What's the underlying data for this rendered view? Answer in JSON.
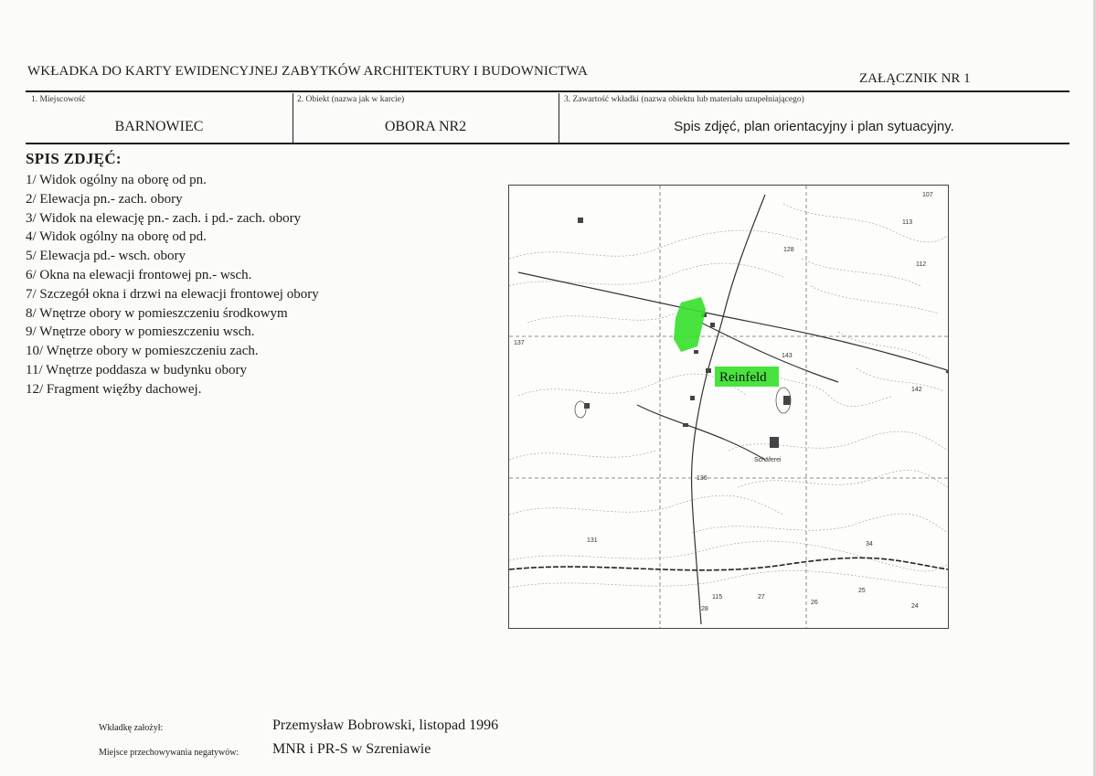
{
  "header": {
    "title": "WKŁADKA DO KARTY EWIDENCYJNEJ ZABYTKÓW ARCHITEKTURY I BUDOWNICTWA",
    "annex": "ZAŁĄCZNIK NR 1"
  },
  "fields": [
    {
      "label": "1. Miejscowość",
      "value": "BARNOWIEC"
    },
    {
      "label": "2. Obiekt (nazwa jak w karcie)",
      "value": "OBORA NR2"
    },
    {
      "label": "3. Zawartość wkładki (nazwa obiektu lub materiału uzupełniającego)",
      "value": "Spis zdjęć, plan orientacyjny i plan sytuacyjny."
    }
  ],
  "photo_list": {
    "title": "SPIS ZDJĘĆ:",
    "items": [
      "1/ Widok ogólny na oborę od pn.",
      "2/ Elewacja pn.- zach. obory",
      "3/ Widok na elewację pn.- zach. i pd.- zach. obory",
      "4/ Widok ogólny na oborę od pd.",
      "5/ Elewacja pd.- wsch. obory",
      "6/ Okna na elewacji frontowej pn.- wsch.",
      "7/ Szczegół okna i drzwi na elewacji frontowej obory",
      "8/ Wnętrze obory w pomieszczeniu środkowym",
      "9/ Wnętrze obory w pomieszczeniu wsch.",
      "10/ Wnętrze obory w pomieszczeniu zach.",
      "11/ Wnętrze poddasza w budynku obory",
      "12/ Fragment więźby dachowej."
    ]
  },
  "map": {
    "place_label": "Reinfeld",
    "highlight_color": "#35e02a",
    "spot_labels": [
      "107",
      "113",
      "128",
      "112",
      "137",
      "143",
      "142",
      "136",
      "131",
      "115",
      "24",
      "25",
      "26",
      "27",
      "28",
      "34",
      "Schäferei"
    ]
  },
  "footer": {
    "author_label": "Wkładkę założył:",
    "author_value": "Przemysław Bobrowski, listopad 1996",
    "storage_label": "Miejsce przechowywania negatywów:",
    "storage_value": "MNR i PR-S w Szreniawie"
  }
}
